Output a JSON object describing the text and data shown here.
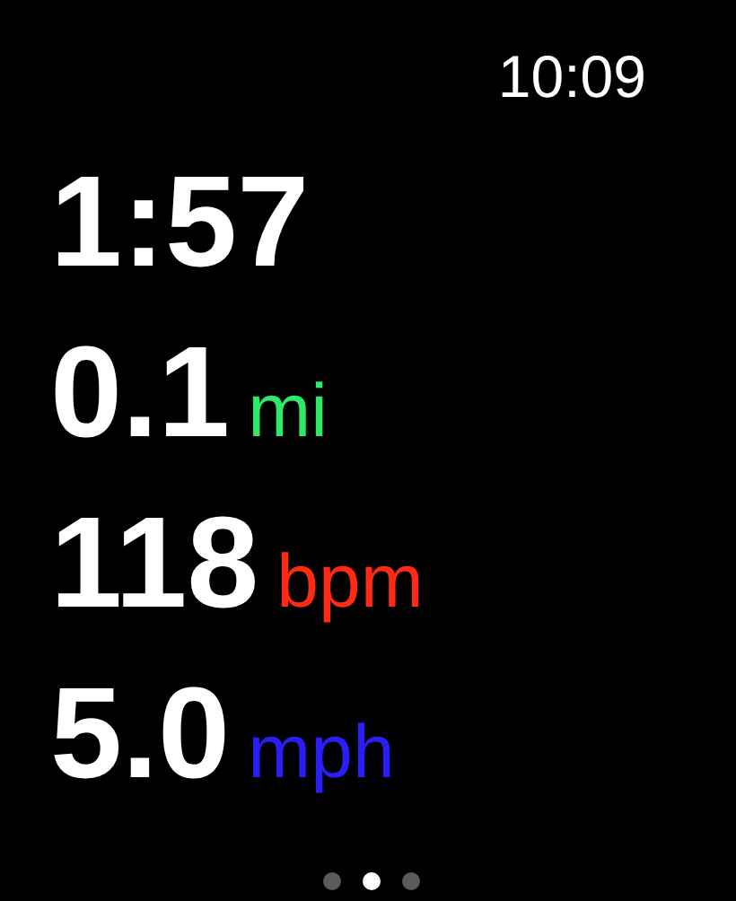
{
  "status_bar": {
    "time": "10:09"
  },
  "metrics": [
    {
      "value": "1:57"
    },
    {
      "value": "0.1",
      "unit": "mi",
      "color": "#2ee86a"
    },
    {
      "value": "118",
      "unit": "bpm",
      "color": "#ff2a12"
    },
    {
      "value": "5.0",
      "unit": "mph",
      "color": "#2a1ef5"
    }
  ],
  "page_dots": [
    {
      "selected": false
    },
    {
      "selected": true
    },
    {
      "selected": false
    }
  ]
}
